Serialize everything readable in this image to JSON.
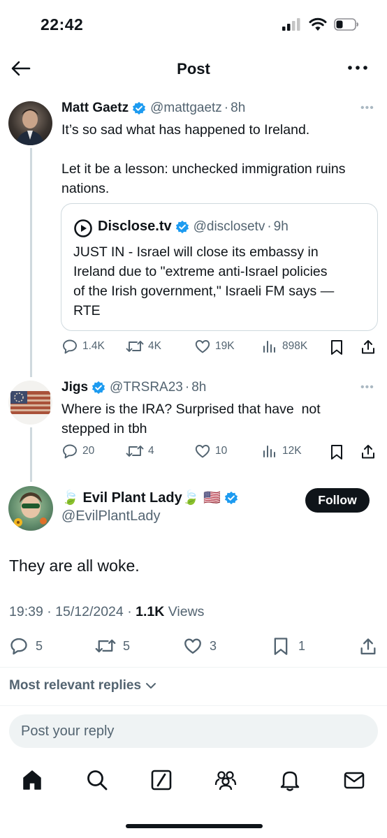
{
  "status_bar": {
    "time": "22:42"
  },
  "header": {
    "title": "Post"
  },
  "thread": [
    {
      "name": "Matt Gaetz",
      "handle": "@mattgaetz",
      "age": "8h",
      "text_lines": [
        "It’s so sad what has happened to Ireland.",
        "",
        "Let it be a lesson: unchecked immigration ruins",
        "nations."
      ],
      "quote": {
        "name": "Disclose.tv",
        "handle": "@disclosetv",
        "age": "9h",
        "text_lines": [
          "JUST IN - Israel will close its embassy in",
          "Ireland due to \"extreme anti-Israel policies",
          "of the Irish government,\" Israeli FM says —",
          "RTE"
        ]
      },
      "stats": {
        "replies": "1.4K",
        "reposts": "4K",
        "likes": "19K",
        "views": "898K"
      }
    },
    {
      "name": "Jigs",
      "handle": "@TRSRA23",
      "age": "8h",
      "text_lines": [
        "Where is the IRA? Surprised that have  not",
        "stepped in tbh"
      ],
      "stats": {
        "replies": "20",
        "reposts": "4",
        "likes": "10",
        "views": "12K"
      }
    }
  ],
  "main_post": {
    "name": "🍃 Evil Plant Lady🍃 🇺🇸",
    "handle": "@EvilPlantLady",
    "follow_label": "Follow",
    "text": "They are all woke.",
    "time": "19:39",
    "date": "15/12/2024",
    "views_count": "1.1K",
    "views_label": "Views",
    "stats": {
      "replies": "5",
      "reposts": "5",
      "likes": "3",
      "bookmarks": "1"
    }
  },
  "sort": {
    "label": "Most relevant replies"
  },
  "reply": {
    "placeholder": "Post your reply"
  },
  "colors": {
    "verified": "#1d9bf0",
    "text": "#0f1419",
    "secondary": "#536471",
    "divider": "#cfd9de"
  },
  "icons": [
    "back-arrow-icon",
    "more-icon",
    "verified-badge-icon",
    "reply-icon",
    "repost-icon",
    "like-icon",
    "views-icon",
    "bookmark-icon",
    "share-icon",
    "home-icon",
    "search-icon",
    "grok-icon",
    "communities-icon",
    "notifications-icon",
    "messages-icon"
  ]
}
